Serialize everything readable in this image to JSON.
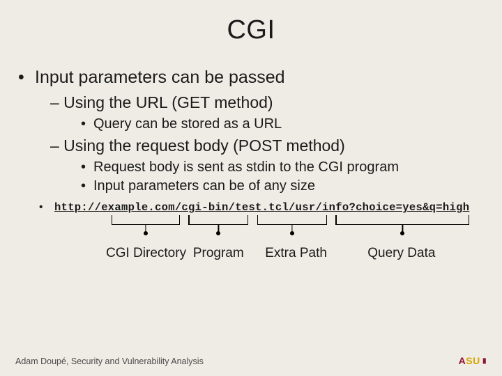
{
  "title": "CGI",
  "bullets": {
    "l1": "Input parameters can be passed",
    "l2a": "– Using the URL (GET method)",
    "l3a": "Query can be stored as a URL",
    "l2b": "– Using the request body (POST method)",
    "l3b": "Request body is sent as stdin to the CGI program",
    "l3c": "Input parameters can be of any size"
  },
  "url": "http://example.com/cgi-bin/test.tcl/usr/info?choice=yes&q=high",
  "url_parts": {
    "cgi_dir": "CGI Directory",
    "program": "Program",
    "extra_path": "Extra Path",
    "query": "Query Data"
  },
  "footer": "Adam Doupé, Security and Vulnerability Analysis",
  "logo": {
    "a": "A",
    "su": "SU"
  }
}
